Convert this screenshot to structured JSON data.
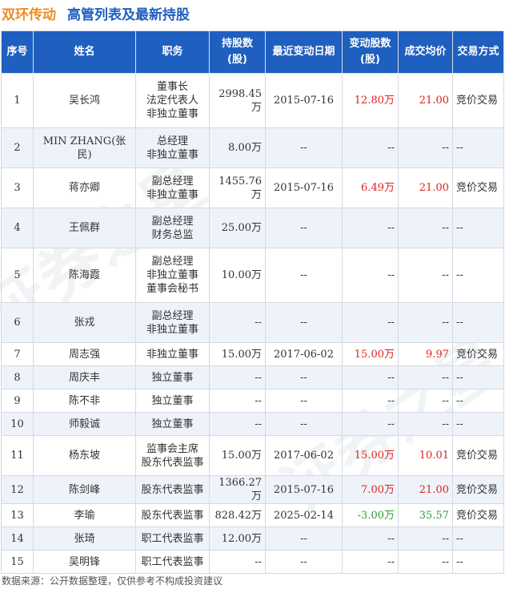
{
  "header": {
    "company": "双环传动",
    "title": "高管列表及最新持股"
  },
  "columns": {
    "idx": "序号",
    "name": "姓名",
    "position": "职务",
    "shares_l1": "持股数",
    "shares_l2": "(股)",
    "date": "最近变动日期",
    "change_l1": "变动股数",
    "change_l2": "(股)",
    "price": "成交均价",
    "mode": "交易方式"
  },
  "rows": [
    {
      "idx": "1",
      "name": "吴长鸿",
      "position": [
        "董事长",
        "法定代表人",
        "非独立董事"
      ],
      "shares": "2998.45万",
      "date": "2015-07-16",
      "change": "12.80万",
      "price": "21.00",
      "mode": "竞价交易",
      "dir": "up"
    },
    {
      "idx": "2",
      "name": "MIN ZHANG(张民)",
      "position": [
        "总经理",
        "非独立董事"
      ],
      "shares": "8.00万",
      "date": "--",
      "change": "--",
      "price": "--",
      "mode": "--",
      "dir": ""
    },
    {
      "idx": "3",
      "name": "蒋亦卿",
      "position": [
        "副总经理",
        "非独立董事"
      ],
      "shares": "1455.76万",
      "date": "2015-07-16",
      "change": "6.49万",
      "price": "21.00",
      "mode": "竞价交易",
      "dir": "up"
    },
    {
      "idx": "4",
      "name": "王佩群",
      "position": [
        "副总经理",
        "财务总监"
      ],
      "shares": "25.00万",
      "date": "--",
      "change": "--",
      "price": "--",
      "mode": "--",
      "dir": ""
    },
    {
      "idx": "5",
      "name": "陈海霞",
      "position": [
        "副总经理",
        "非独立董事",
        "董事会秘书"
      ],
      "shares": "10.00万",
      "date": "--",
      "change": "--",
      "price": "--",
      "mode": "--",
      "dir": ""
    },
    {
      "idx": "6",
      "name": "张戎",
      "position": [
        "副总经理",
        "非独立董事"
      ],
      "shares": "--",
      "date": "--",
      "change": "--",
      "price": "--",
      "mode": "--",
      "dir": ""
    },
    {
      "idx": "7",
      "name": "周志强",
      "position": [
        "非独立董事"
      ],
      "shares": "15.00万",
      "date": "2017-06-02",
      "change": "15.00万",
      "price": "9.97",
      "mode": "竞价交易",
      "dir": "up"
    },
    {
      "idx": "8",
      "name": "周庆丰",
      "position": [
        "独立董事"
      ],
      "shares": "--",
      "date": "--",
      "change": "--",
      "price": "--",
      "mode": "--",
      "dir": ""
    },
    {
      "idx": "9",
      "name": "陈不非",
      "position": [
        "独立董事"
      ],
      "shares": "--",
      "date": "--",
      "change": "--",
      "price": "--",
      "mode": "--",
      "dir": ""
    },
    {
      "idx": "10",
      "name": "师毅诚",
      "position": [
        "独立董事"
      ],
      "shares": "--",
      "date": "--",
      "change": "--",
      "price": "--",
      "mode": "--",
      "dir": ""
    },
    {
      "idx": "11",
      "name": "杨东坡",
      "position": [
        "监事会主席",
        "股东代表监事"
      ],
      "shares": "15.00万",
      "date": "2017-06-02",
      "change": "15.00万",
      "price": "10.01",
      "mode": "竞价交易",
      "dir": "up"
    },
    {
      "idx": "12",
      "name": "陈剑峰",
      "position": [
        "股东代表监事"
      ],
      "shares": "1366.27万",
      "date": "2015-07-16",
      "change": "7.00万",
      "price": "21.00",
      "mode": "竞价交易",
      "dir": "up"
    },
    {
      "idx": "13",
      "name": "李瑜",
      "position": [
        "股东代表监事"
      ],
      "shares": "828.42万",
      "date": "2025-02-14",
      "change": "-3.00万",
      "price": "35.57",
      "mode": "竞价交易",
      "dir": "down"
    },
    {
      "idx": "14",
      "name": "张琦",
      "position": [
        "职工代表监事"
      ],
      "shares": "12.00万",
      "date": "--",
      "change": "--",
      "price": "--",
      "mode": "--",
      "dir": ""
    },
    {
      "idx": "15",
      "name": "吴明锋",
      "position": [
        "职工代表监事"
      ],
      "shares": "--",
      "date": "--",
      "change": "--",
      "price": "--",
      "mode": "--",
      "dir": ""
    }
  ],
  "footer": "数据来源：公开数据整理，仅供参考不构成投资建议",
  "watermark": "证券之星",
  "colors": {
    "header_bg": "#1f5fbf",
    "company": "#f08a24",
    "up": "#e0231f",
    "down": "#2e9e3a"
  }
}
